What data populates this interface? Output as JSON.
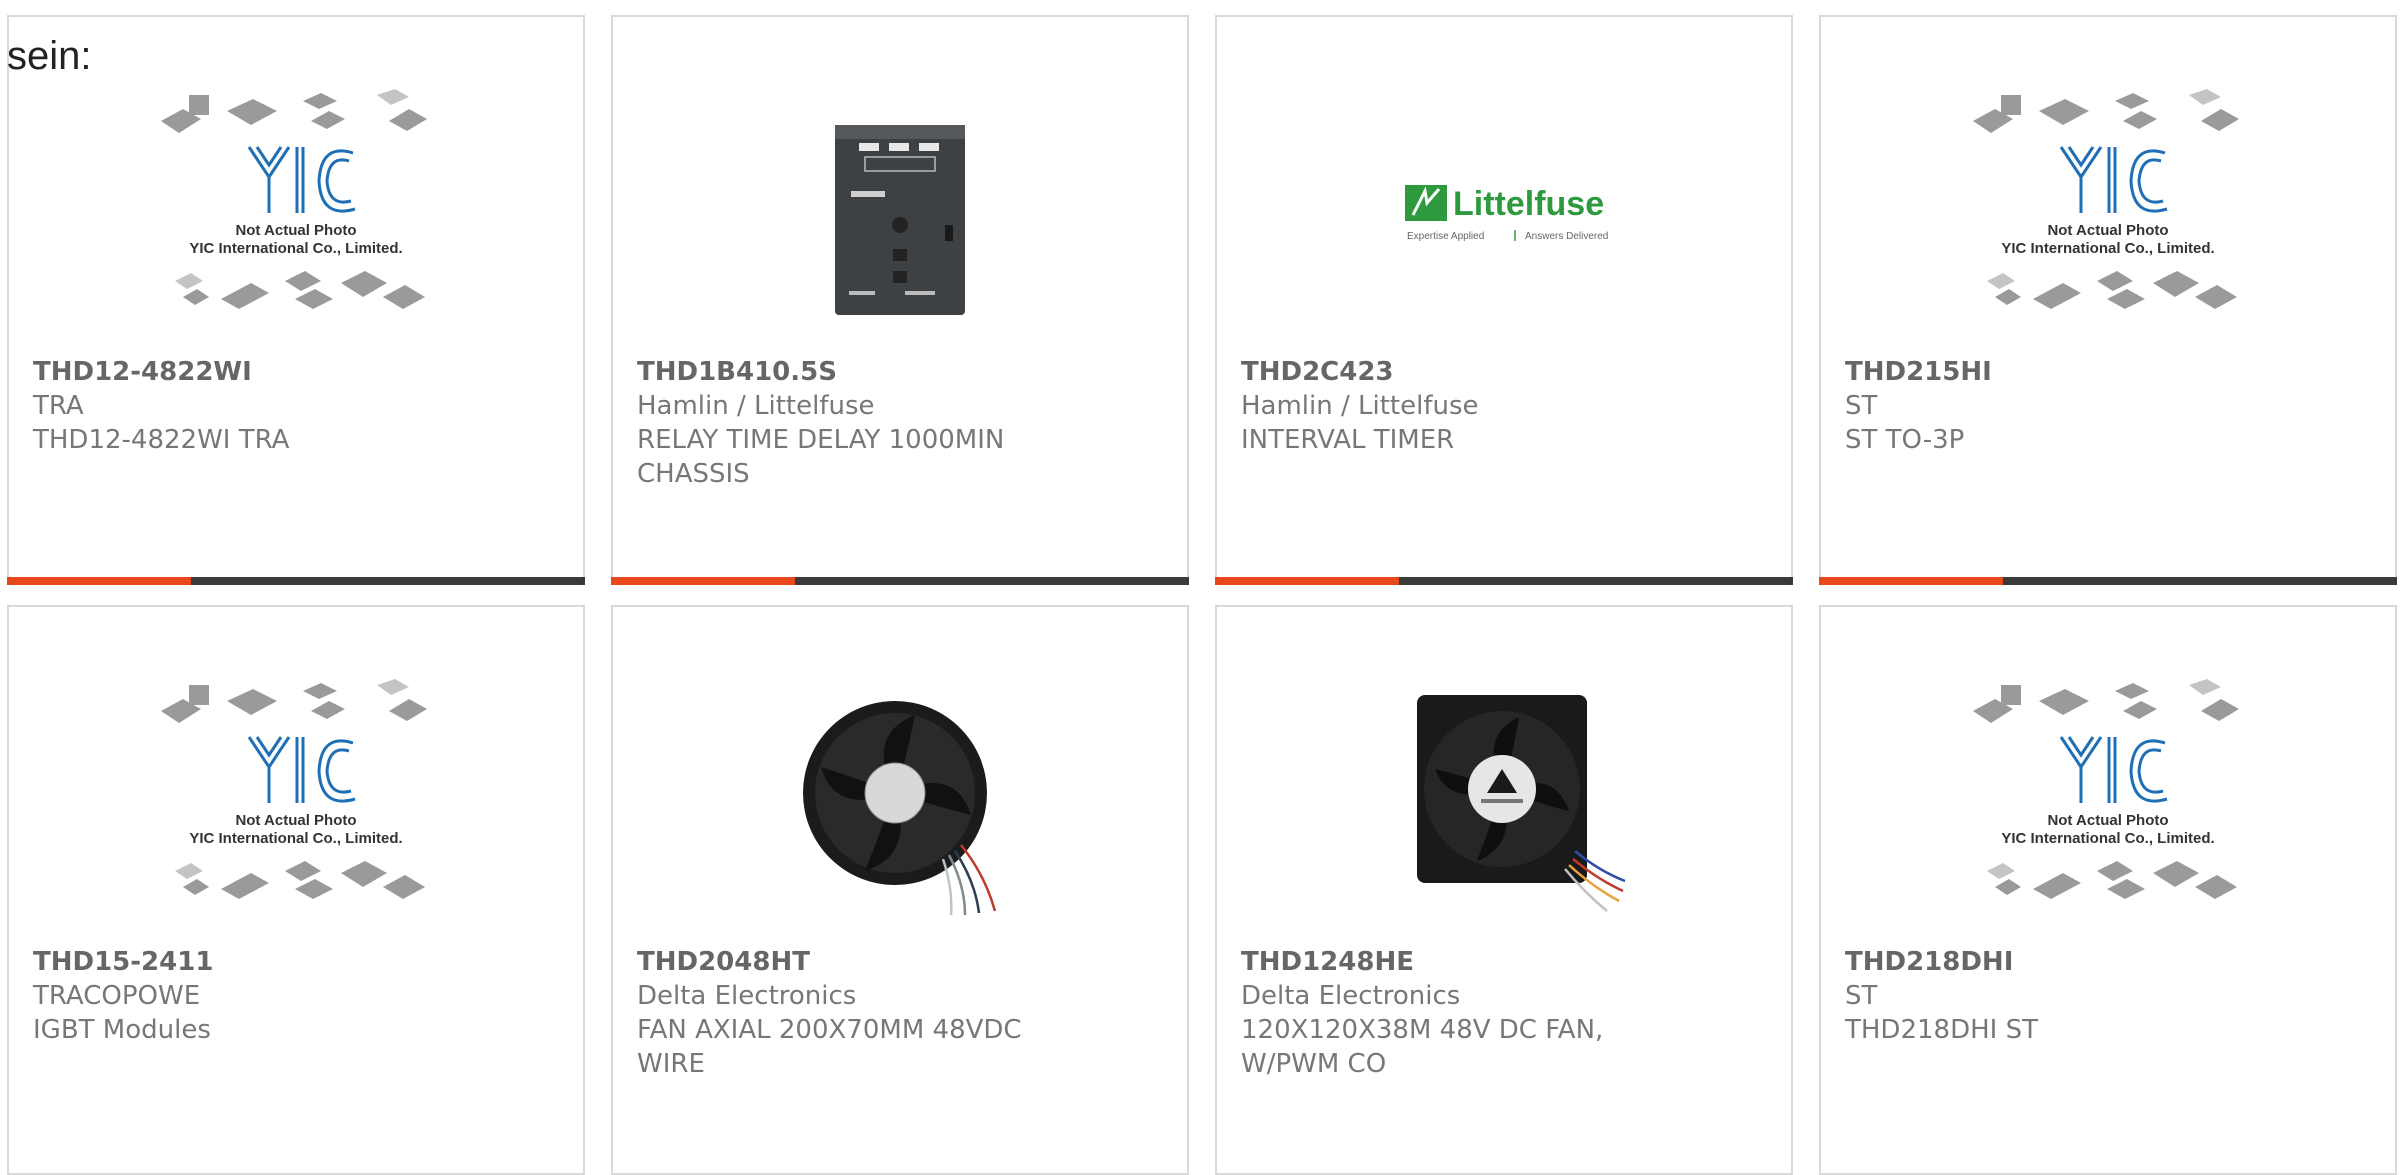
{
  "page": {
    "heading": "sein:"
  },
  "colors": {
    "accent": "#e8461b",
    "bar": "#3a3a3a",
    "border": "#d9d9d9",
    "text": "#777777",
    "littelfuse_green": "#2e9a3e",
    "yic_blue": "#1f6fb6"
  },
  "placeholder": {
    "line1": "Not Actual Photo",
    "line2": "YIC International Co., Limited."
  },
  "brand": {
    "name": "Littelfuse",
    "tagline_left": "Expertise Applied",
    "tagline_right": "Answers Delivered"
  },
  "products": [
    {
      "part_number": "THD12-4822WI",
      "manufacturer": "TRA",
      "description": "THD12-4822WI TRA",
      "image": "placeholder-photo"
    },
    {
      "part_number": "THD1B410.5S",
      "manufacturer": "Hamlin / Littelfuse",
      "description": "RELAY TIME DELAY 1000MIN CHASSIS",
      "image": "relay-photo"
    },
    {
      "part_number": "THD2C423",
      "manufacturer": "Hamlin / Littelfuse",
      "description": "INTERVAL TIMER",
      "image": "littelfuse-logo"
    },
    {
      "part_number": "THD215HI",
      "manufacturer": "ST",
      "description": "ST TO-3P",
      "image": "placeholder-photo"
    },
    {
      "part_number": "THD15-2411",
      "manufacturer": "TRACOPOWE",
      "description": "IGBT Modules",
      "image": "placeholder-photo"
    },
    {
      "part_number": "THD2048HT",
      "manufacturer": "Delta Electronics",
      "description": "FAN AXIAL 200X70MM 48VDC WIRE",
      "image": "round-fan-photo"
    },
    {
      "part_number": "THD1248HE",
      "manufacturer": "Delta Electronics",
      "description": "120X120X38M 48V DC FAN, W/PWM CO",
      "image": "square-fan-photo"
    },
    {
      "part_number": "THD218DHI",
      "manufacturer": "ST",
      "description": "THD218DHI ST",
      "image": "placeholder-photo"
    }
  ]
}
